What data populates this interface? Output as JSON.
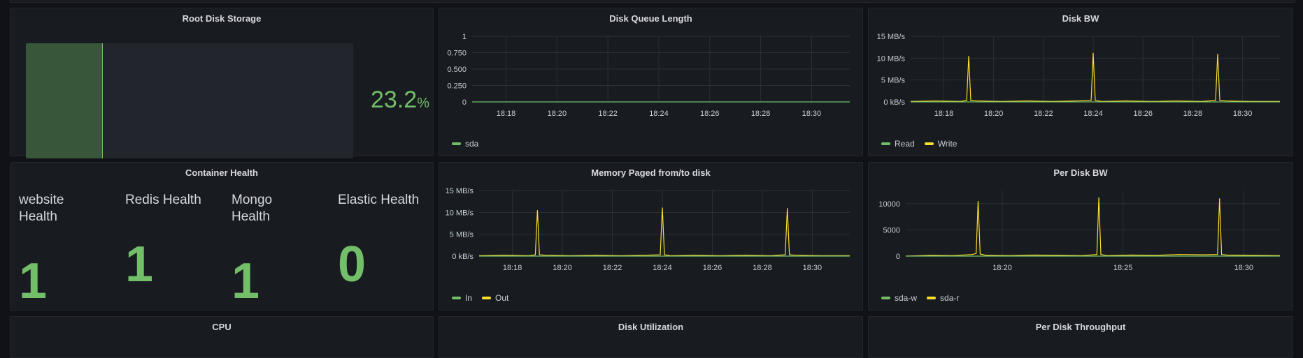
{
  "colors": {
    "green": "#73bf69",
    "yellow": "#fade2a",
    "grid": "#2c3036",
    "panel_bg": "#181b1f"
  },
  "root_disk": {
    "title": "Root Disk Storage",
    "value": "23.2",
    "unit": "%",
    "fill_fraction": 0.232
  },
  "container_health": {
    "title": "Container Health",
    "items": [
      {
        "label": "website Health",
        "value": "1"
      },
      {
        "label": "Redis Health",
        "value": "1"
      },
      {
        "label": "Mongo Health",
        "value": "1"
      },
      {
        "label": "Elastic Health",
        "value": "0"
      }
    ]
  },
  "bottom_panels": {
    "cpu": "CPU",
    "disk_util": "Disk Utilization",
    "per_disk_throughput": "Per Disk Throughput"
  },
  "chart_data": [
    {
      "id": "disk_queue",
      "type": "line",
      "title": "Disk Queue Length",
      "x_ticks": [
        "18:18",
        "18:20",
        "18:22",
        "18:24",
        "18:26",
        "18:28",
        "18:30"
      ],
      "y_ticks": [
        "1",
        "0.750",
        "0.500",
        "0.250",
        "0"
      ],
      "ylim": [
        0,
        1
      ],
      "xlim": [
        "18:16:40",
        "18:31:30"
      ],
      "grid": true,
      "legend_position": "bottom-left",
      "series": [
        {
          "name": "sda",
          "color": "#73bf69",
          "x": [
            "18:16:40",
            "18:31:30"
          ],
          "values": [
            0,
            0
          ]
        }
      ]
    },
    {
      "id": "disk_bw",
      "type": "line",
      "title": "Disk BW",
      "x_ticks": [
        "18:18",
        "18:20",
        "18:22",
        "18:24",
        "18:26",
        "18:28",
        "18:30"
      ],
      "y_ticks": [
        "15 MB/s",
        "10 MB/s",
        "5 MB/s",
        "0 kB/s"
      ],
      "ylim": [
        0,
        15
      ],
      "y_unit": "MB/s",
      "xlim": [
        "18:16:40",
        "18:31:30"
      ],
      "grid": true,
      "legend_position": "bottom-left",
      "series": [
        {
          "name": "Read",
          "color": "#73bf69",
          "x": [
            "18:16:40",
            "18:31:30"
          ],
          "values": [
            0,
            0
          ]
        },
        {
          "name": "Write",
          "color": "#fade2a",
          "x": [
            "18:16:40",
            "18:17:40",
            "18:18:40",
            "18:18:55",
            "18:19:00",
            "18:19:05",
            "18:19:20",
            "18:20:20",
            "18:21:20",
            "18:22:20",
            "18:23:20",
            "18:23:55",
            "18:24:00",
            "18:24:05",
            "18:24:20",
            "18:25:20",
            "18:26:20",
            "18:27:20",
            "18:28:20",
            "18:28:55",
            "18:29:00",
            "18:29:05",
            "18:29:20",
            "18:30:20",
            "18:31:30"
          ],
          "values": [
            0.1,
            0.2,
            0.1,
            0.3,
            10.5,
            0.3,
            0.2,
            0.1,
            0.2,
            0.1,
            0.2,
            0.3,
            11.2,
            0.3,
            0.1,
            0.2,
            0.1,
            0.2,
            0.1,
            0.3,
            11.0,
            0.3,
            0.2,
            0.1,
            0.1
          ]
        }
      ]
    },
    {
      "id": "mem_paged",
      "type": "line",
      "title": "Memory Paged from/to disk",
      "x_ticks": [
        "18:18",
        "18:20",
        "18:22",
        "18:24",
        "18:26",
        "18:28",
        "18:30"
      ],
      "y_ticks": [
        "15 MB/s",
        "10 MB/s",
        "5 MB/s",
        "0 kB/s"
      ],
      "ylim": [
        0,
        15
      ],
      "y_unit": "MB/s",
      "xlim": [
        "18:16:40",
        "18:31:30"
      ],
      "grid": true,
      "legend_position": "bottom-left",
      "series": [
        {
          "name": "In",
          "color": "#73bf69",
          "x": [
            "18:16:40",
            "18:31:30"
          ],
          "values": [
            0,
            0
          ]
        },
        {
          "name": "Out",
          "color": "#fade2a",
          "x": [
            "18:16:40",
            "18:17:40",
            "18:18:40",
            "18:18:55",
            "18:19:00",
            "18:19:05",
            "18:19:20",
            "18:20:20",
            "18:21:20",
            "18:22:20",
            "18:23:20",
            "18:23:55",
            "18:24:00",
            "18:24:05",
            "18:24:20",
            "18:25:20",
            "18:26:20",
            "18:27:20",
            "18:28:20",
            "18:28:55",
            "18:29:00",
            "18:29:05",
            "18:29:20",
            "18:30:20",
            "18:31:30"
          ],
          "values": [
            0.1,
            0.2,
            0.1,
            0.3,
            10.5,
            0.3,
            0.2,
            0.1,
            0.2,
            0.1,
            0.2,
            0.3,
            11.1,
            0.3,
            0.1,
            0.2,
            0.1,
            0.2,
            0.1,
            0.3,
            11.0,
            0.3,
            0.2,
            0.1,
            0.1
          ]
        }
      ]
    },
    {
      "id": "per_disk_bw",
      "type": "line",
      "title": "Per Disk BW",
      "x_ticks": [
        "18:20",
        "18:25",
        "18:30"
      ],
      "y_ticks": [
        "10000",
        "5000",
        "0"
      ],
      "ylim": [
        0,
        12500
      ],
      "xlim": [
        "18:16:00",
        "18:31:30"
      ],
      "grid": true,
      "legend_position": "bottom-left",
      "series": [
        {
          "name": "sda-w",
          "color": "#73bf69",
          "x": [
            "18:16:00",
            "18:31:30"
          ],
          "values": [
            0,
            0
          ]
        },
        {
          "name": "sda-r",
          "color": "#fade2a",
          "x": [
            "18:16:00",
            "18:17:00",
            "18:18:00",
            "18:18:45",
            "18:18:55",
            "18:19:00",
            "18:19:05",
            "18:19:20",
            "18:20:20",
            "18:21:20",
            "18:22:20",
            "18:23:20",
            "18:23:55",
            "18:24:00",
            "18:24:05",
            "18:24:20",
            "18:25:20",
            "18:26:20",
            "18:27:20",
            "18:28:20",
            "18:28:55",
            "18:29:00",
            "18:29:05",
            "18:29:20",
            "18:30:20",
            "18:31:30"
          ],
          "values": [
            0,
            150,
            100,
            300,
            500,
            10500,
            400,
            150,
            100,
            200,
            150,
            100,
            300,
            11200,
            300,
            100,
            200,
            150,
            300,
            250,
            300,
            11000,
            300,
            200,
            150,
            100
          ]
        }
      ]
    }
  ]
}
